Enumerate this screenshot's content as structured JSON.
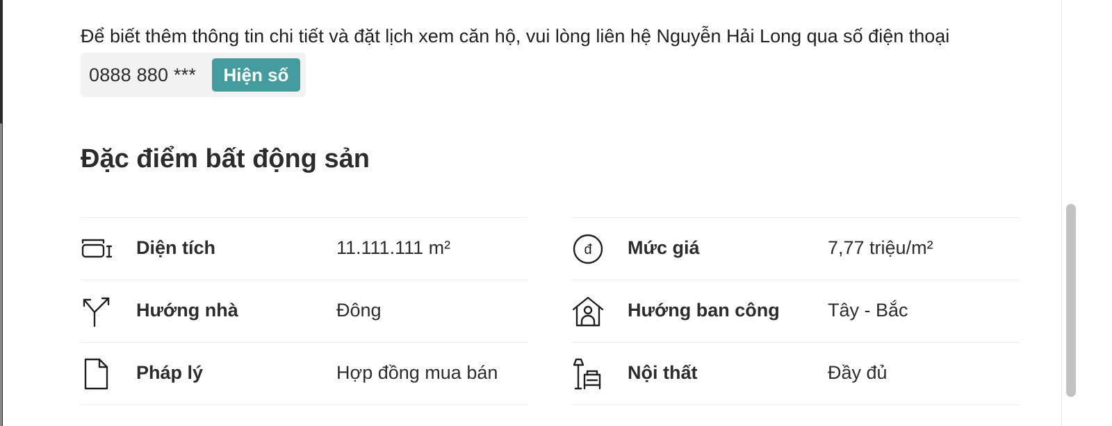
{
  "contact": {
    "text": "Để biết thêm thông tin chi tiết và đặt lịch xem căn hộ, vui lòng liên hệ Nguyễn Hải Long qua số điện thoại",
    "phone_masked": "0888 880 ***",
    "show_button_label": "Hiện số"
  },
  "section": {
    "title": "Đặc điểm bất động sản"
  },
  "features": {
    "left": [
      {
        "icon": "area-icon",
        "label": "Diện tích",
        "value": "11.111.111 m²"
      },
      {
        "icon": "direction-icon",
        "label": "Hướng nhà",
        "value": "Đông"
      },
      {
        "icon": "document-icon",
        "label": "Pháp lý",
        "value": "Hợp đồng mua bán"
      }
    ],
    "right": [
      {
        "icon": "price-icon",
        "label": "Mức giá",
        "value": "7,77 triệu/m²"
      },
      {
        "icon": "balcony-icon",
        "label": "Hướng ban công",
        "value": "Tây - Bắc"
      },
      {
        "icon": "furniture-icon",
        "label": "Nội thất",
        "value": "Đầy đủ"
      }
    ]
  },
  "colors": {
    "accent": "#449c9f",
    "text": "#2c2c2c",
    "phone_box_bg": "#f2f2f2",
    "divider": "#ececec"
  }
}
